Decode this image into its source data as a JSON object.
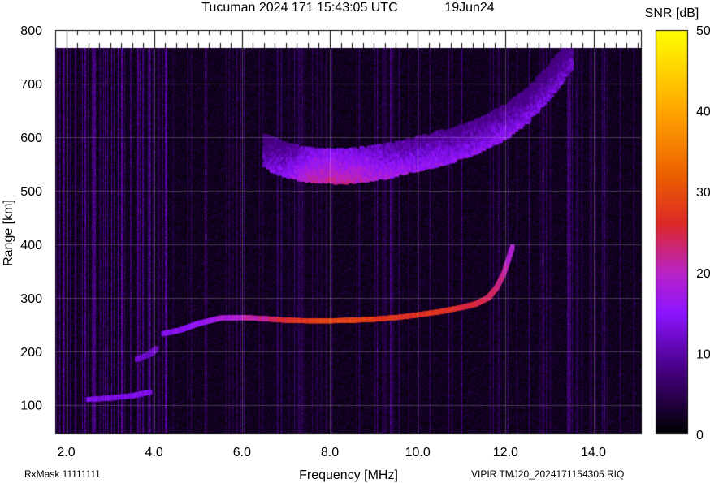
{
  "chart_data": {
    "type": "heatmap",
    "title": "Tucuman 2024 171 15:43:05 UTC",
    "date": "19Jun24",
    "xlabel": "Frequency [MHz]",
    "ylabel": "Range [km]",
    "xlim": [
      1.75,
      15.1
    ],
    "ylim": [
      45,
      800
    ],
    "xticks": [
      "2.0",
      "4.0",
      "6.0",
      "8.0",
      "10.0",
      "12.0",
      "14.0"
    ],
    "xtick_values": [
      2,
      4,
      6,
      8,
      10,
      12,
      14
    ],
    "yticks": [
      "100",
      "200",
      "300",
      "400",
      "500",
      "600",
      "700",
      "800"
    ],
    "ytick_values": [
      100,
      200,
      300,
      400,
      500,
      600,
      700,
      800
    ],
    "colorbar": {
      "label": "SNR [dB]",
      "min": 0,
      "max": 50,
      "ticks": [
        "0",
        "10",
        "20",
        "30",
        "40",
        "50"
      ],
      "tick_values": [
        0,
        10,
        20,
        30,
        40,
        50
      ]
    },
    "grid": true,
    "traces": [
      {
        "name": "",
        "points": [
          [
            2.5,
            110
          ],
          [
            3.0,
            113
          ],
          [
            3.5,
            117
          ],
          [
            3.9,
            124
          ]
        ],
        "snr": 14
      },
      {
        "name": "",
        "points": [
          [
            3.6,
            185
          ],
          [
            3.9,
            195
          ],
          [
            4.05,
            205
          ]
        ],
        "snr": 12
      },
      {
        "name": "",
        "points": [
          [
            4.2,
            233
          ],
          [
            4.6,
            240
          ],
          [
            5.0,
            252
          ],
          [
            5.5,
            262
          ],
          [
            6.0,
            263
          ],
          [
            6.5,
            261
          ],
          [
            7.0,
            258
          ],
          [
            7.5,
            257
          ],
          [
            8.0,
            257
          ],
          [
            8.5,
            258
          ],
          [
            9.0,
            260
          ],
          [
            9.5,
            263
          ],
          [
            10.0,
            268
          ],
          [
            10.5,
            274
          ],
          [
            11.0,
            282
          ],
          [
            11.3,
            288
          ],
          [
            11.6,
            300
          ],
          [
            11.8,
            320
          ],
          [
            11.95,
            345
          ],
          [
            12.05,
            370
          ],
          [
            12.15,
            395
          ]
        ],
        "snr": [
          14,
          15,
          16,
          18,
          20,
          22,
          26,
          28,
          29,
          29,
          28,
          27,
          27,
          27,
          26,
          25,
          24,
          23,
          22,
          20,
          18
        ]
      },
      {
        "name": "",
        "points": [
          [
            6.5,
            545
          ],
          [
            7.0,
            528
          ],
          [
            7.5,
            520
          ],
          [
            8.0,
            516
          ],
          [
            8.5,
            518
          ],
          [
            9.0,
            522
          ],
          [
            9.5,
            530
          ],
          [
            10.0,
            540
          ],
          [
            10.5,
            550
          ],
          [
            11.0,
            562
          ],
          [
            11.5,
            578
          ],
          [
            12.0,
            600
          ],
          [
            12.5,
            630
          ],
          [
            13.0,
            675
          ],
          [
            13.5,
            730
          ]
        ],
        "snr": [
          13,
          15,
          20,
          22,
          21,
          19,
          17,
          16,
          16,
          15,
          15,
          15,
          14,
          13,
          12
        ]
      }
    ],
    "annotations": {
      "bottom_left": "RxMask 11111111",
      "bottom_right": "VIPIR  TMJ20_2024171154305.RIQ"
    }
  }
}
